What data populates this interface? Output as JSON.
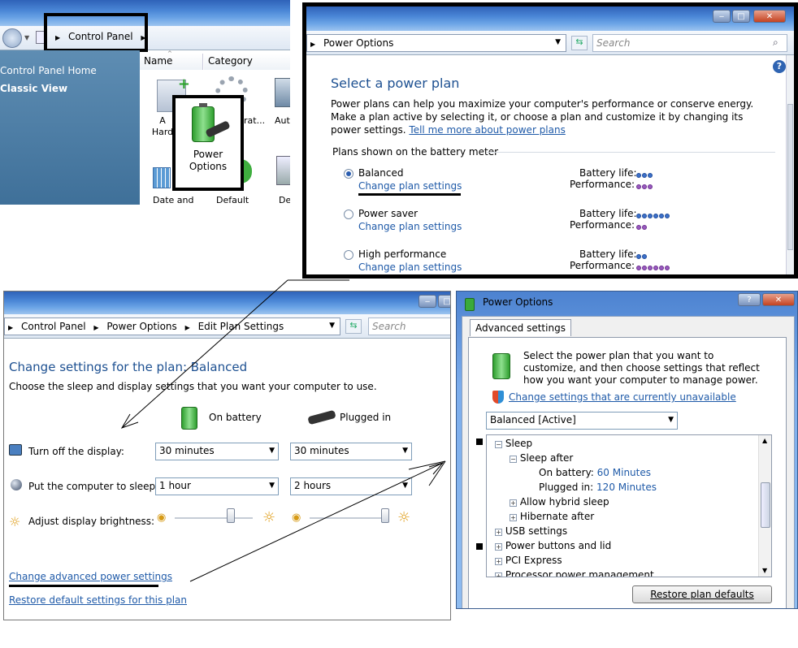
{
  "cp": {
    "address": "Control Panel",
    "sidebar": [
      "Control Panel Home",
      "Classic View"
    ],
    "col_name": "Name",
    "col_category": "Category",
    "icons": [
      {
        "label": "A\nHard"
      },
      {
        "label": "rat..."
      },
      {
        "label": "Aut"
      },
      {
        "label": "Date and"
      },
      {
        "label": "Default"
      },
      {
        "label": "De"
      }
    ],
    "power_options_label": "Power\nOptions"
  },
  "plan": {
    "address": "Power Options",
    "search_placeholder": "Search",
    "heading": "Select a power plan",
    "intro": "Power plans can help you maximize your computer's performance or conserve energy. Make a plan active by selecting it, or choose a plan and customize it by changing its power settings.",
    "tell_more": "Tell me more about power plans",
    "group_title": "Plans shown on the battery meter",
    "battery_label": "Battery life:",
    "performance_label": "Performance:",
    "change_link": "Change plan settings",
    "plans": [
      {
        "name": "Balanced",
        "selected": true,
        "battery": 3,
        "performance": 3
      },
      {
        "name": "Power saver",
        "selected": false,
        "battery": 6,
        "performance": 2
      },
      {
        "name": "High performance",
        "selected": false,
        "battery": 2,
        "performance": 6
      }
    ]
  },
  "edit": {
    "breadcrumb": [
      "Control Panel",
      "Power Options",
      "Edit Plan Settings"
    ],
    "search_placeholder": "Search",
    "heading": "Change settings for the plan: Balanced",
    "subtitle": "Choose the sleep and display settings that you want your computer to use.",
    "on_battery": "On battery",
    "plugged_in": "Plugged in",
    "rows": [
      {
        "label": "Turn off the display:",
        "battery": "30 minutes",
        "plugged": "30 minutes"
      },
      {
        "label": "Put the computer to sleep:",
        "battery": "1 hour",
        "plugged": "2 hours"
      },
      {
        "label": "Adjust display brightness:"
      }
    ],
    "advanced_link": "Change advanced power settings",
    "restore_link": "Restore default settings for this plan"
  },
  "adv": {
    "title": "Power Options",
    "tab": "Advanced settings",
    "description": "Select the power plan that you want to customize, and then choose settings that reflect how you want your computer to manage power.",
    "unavailable_link": "Change settings that are currently unavailable",
    "plan_select": "Balanced [Active]",
    "tree": {
      "sleep": "Sleep",
      "sleep_after": "Sleep after",
      "on_battery_label": "On battery:",
      "on_battery_value": "60 Minutes",
      "plugged_label": "Plugged in:",
      "plugged_value": "120 Minutes",
      "hybrid": "Allow hybrid sleep",
      "hibernate": "Hibernate after",
      "usb": "USB settings",
      "buttons": "Power buttons and lid",
      "pci": "PCI Express",
      "processor": "Processor power management"
    },
    "restore_button": "Restore plan defaults"
  },
  "colors": {
    "link": "#1f5aa8",
    "heading": "#1d5091",
    "cp_sidebar": "#4a7fa7"
  }
}
